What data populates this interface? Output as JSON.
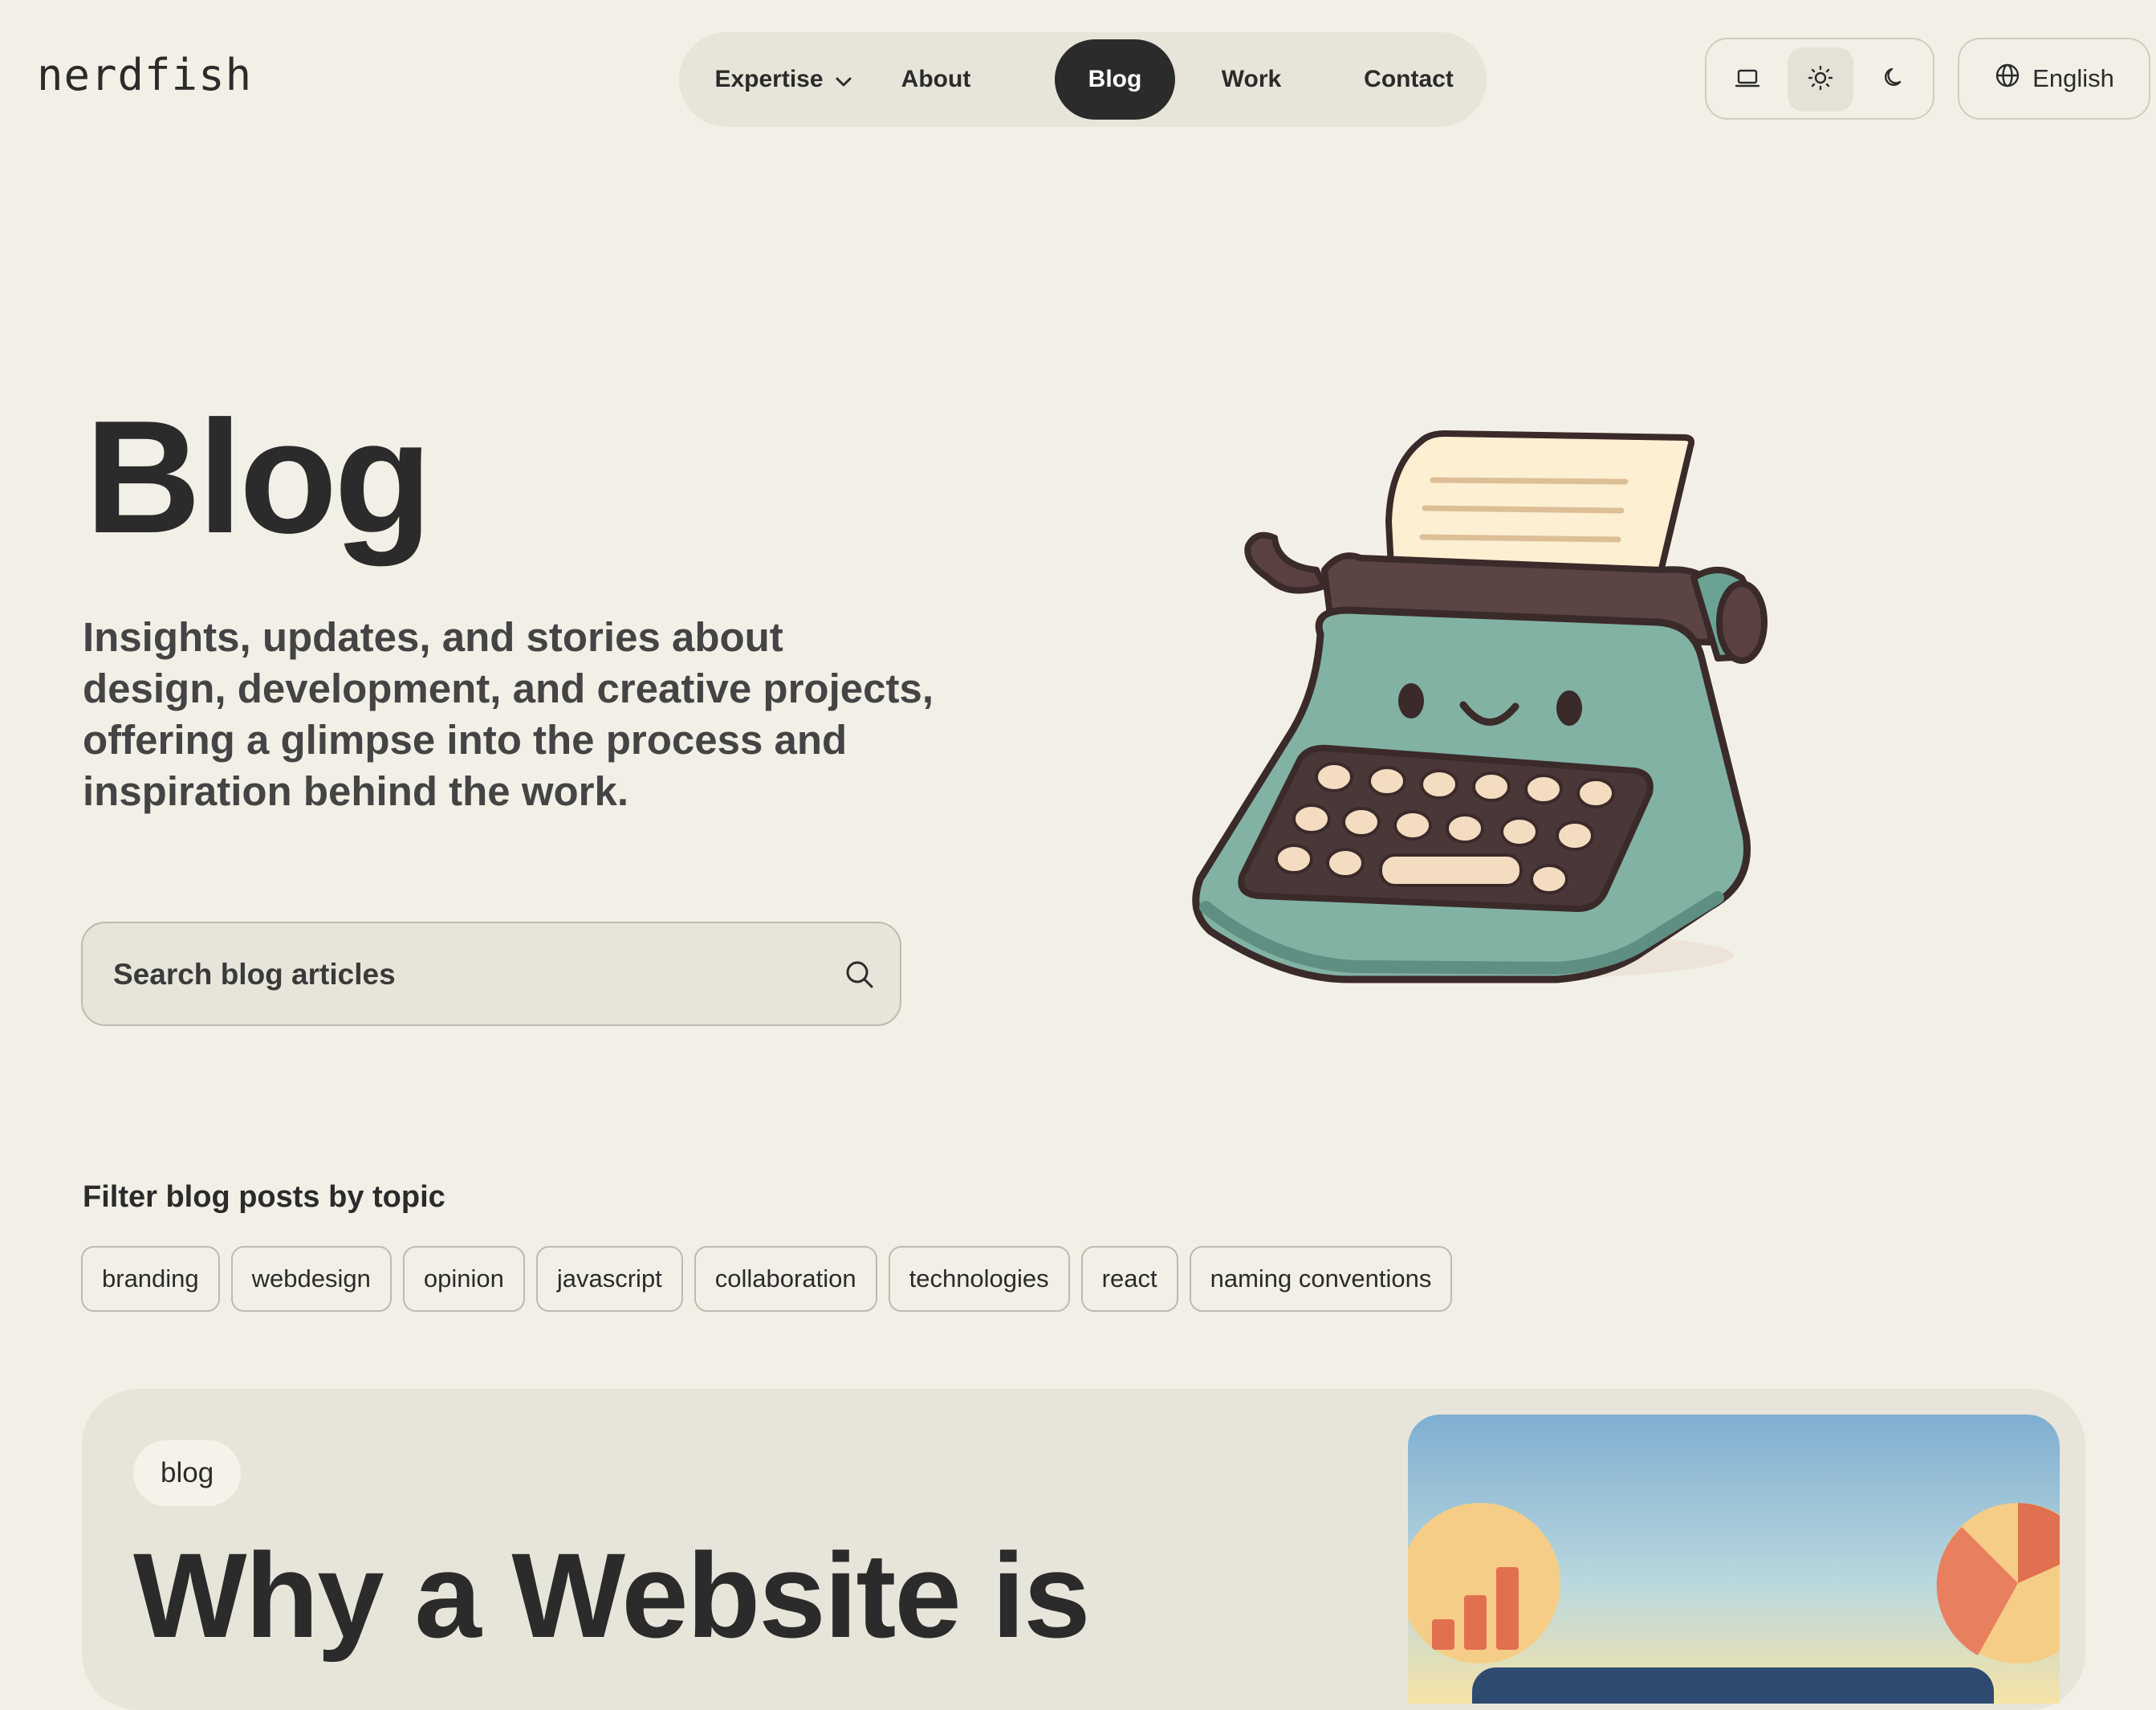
{
  "header": {
    "logo": "nerdfish",
    "nav": {
      "items": [
        "Expertise",
        "About",
        "Blog",
        "Work",
        "Contact"
      ],
      "active": "Blog"
    },
    "theme": {
      "options": [
        "laptop-icon",
        "sun-icon",
        "moon-icon"
      ],
      "selected": "sun-icon"
    },
    "language": "English"
  },
  "hero": {
    "title": "Blog",
    "description": "Insights, updates, and stories about design, development, and creative projects, offering a glimpse into the process and inspiration behind the work.",
    "search_placeholder": "Search blog articles"
  },
  "filter": {
    "heading": "Filter blog posts by topic",
    "tags": [
      "branding",
      "webdesign",
      "opinion",
      "javascript",
      "collaboration",
      "technologies",
      "react",
      "naming conventions"
    ]
  },
  "featured": {
    "tag": "blog",
    "title": "Why a Website is"
  },
  "colors": {
    "background": "#f2f0e6",
    "surface": "#e7e5da",
    "text": "#2b2b2b",
    "typewriter": "#7fae9f"
  }
}
